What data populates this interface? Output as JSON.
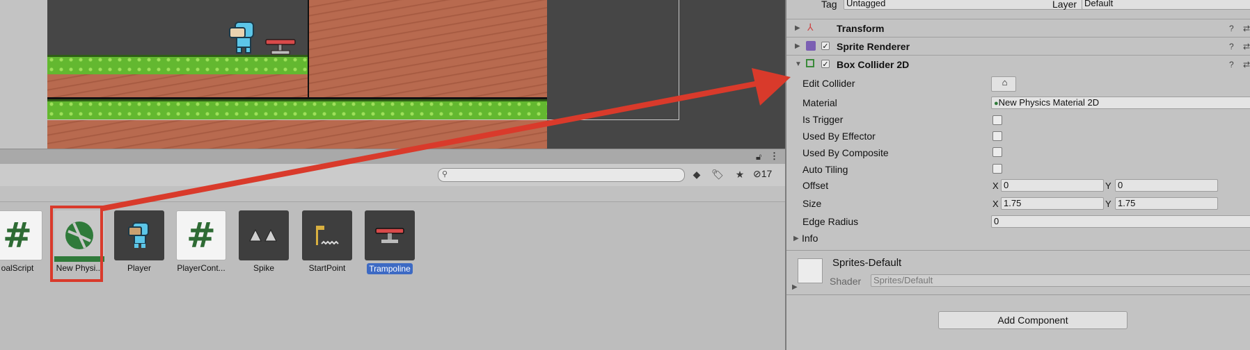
{
  "project": {
    "hidden_count": "17",
    "assets": [
      {
        "label": "oalScript",
        "kind": "script"
      },
      {
        "label": "New Physi...",
        "kind": "physics-material"
      },
      {
        "label": "Player",
        "kind": "sprite"
      },
      {
        "label": "PlayerCont...",
        "kind": "script"
      },
      {
        "label": "Spike",
        "kind": "sprite"
      },
      {
        "label": "StartPoint",
        "kind": "sprite"
      },
      {
        "label": "Trampoline",
        "kind": "sprite",
        "selected": true
      }
    ],
    "script_glyph": "#"
  },
  "inspector": {
    "tag_label": "Tag",
    "tag_value": "Untagged",
    "layer_label": "Layer",
    "layer_value": "Default",
    "components": [
      {
        "name": "Transform"
      },
      {
        "name": "Sprite Renderer"
      },
      {
        "name": "Box Collider 2D"
      }
    ],
    "box_collider": {
      "edit_collider": "Edit Collider",
      "material_label": "Material",
      "material_value": "New Physics Material 2D",
      "is_trigger": "Is Trigger",
      "used_by_effector": "Used By Effector",
      "used_by_composite": "Used By Composite",
      "auto_tiling": "Auto Tiling",
      "offset_label": "Offset",
      "offset_x": "0",
      "offset_y": "0",
      "size_label": "Size",
      "size_x": "1.75",
      "size_y": "1.75",
      "edge_radius_label": "Edge Radius",
      "edge_radius": "0",
      "info_label": "Info",
      "x_letter": "X",
      "y_letter": "Y"
    },
    "material_section": {
      "name": "Sprites-Default",
      "shader_label": "Shader",
      "shader_value": "Sprites/Default"
    },
    "add_component": "Add Component"
  },
  "annotation": {
    "color": "#d93a2b"
  }
}
